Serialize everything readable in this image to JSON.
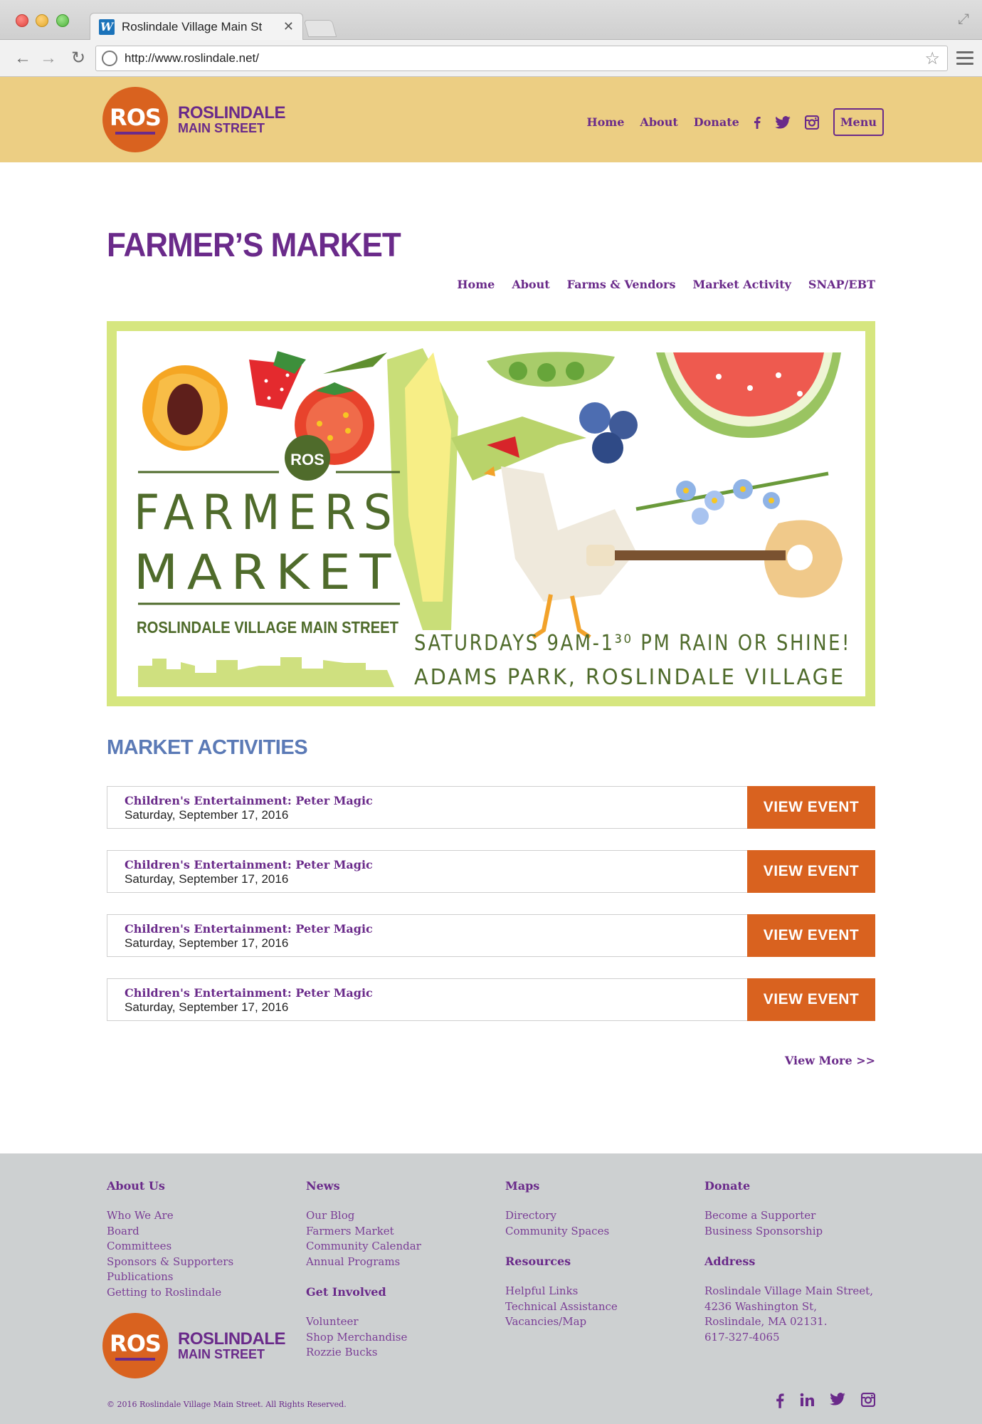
{
  "browser": {
    "tab_title": "Roslindale Village Main St",
    "favicon_letter": "W",
    "url": "http://www.roslindale.net/"
  },
  "header": {
    "logo_mark": "ROS",
    "logo_line1": "ROSLINDALE",
    "logo_line2": "MAIN STREET",
    "nav": [
      "Home",
      "About",
      "Donate"
    ],
    "menu_label": "Menu",
    "social_icons": [
      "facebook-icon",
      "twitter-icon",
      "instagram-icon"
    ]
  },
  "page": {
    "title": "FARMER’S MARKET",
    "sub_nav": [
      "Home",
      "About",
      "Farms & Vendors",
      "Market Activity",
      "SNAP/EBT"
    ]
  },
  "banner": {
    "badge": "ROS",
    "line1": "FARMERS",
    "line2": "MARKET",
    "org": "ROSLINDALE VILLAGE MAIN STREET",
    "schedule": "SATURDAYS 9AM-1³⁰ PM RAIN OR SHINE!",
    "location": "ADAMS PARK, ROSLINDALE VILLAGE"
  },
  "activities": {
    "title": "MARKET ACTIVITIES",
    "button_label": "VIEW EVENT",
    "events": [
      {
        "title": "Children's Entertainment: Peter Magic",
        "date": "Saturday, September 17, 2016"
      },
      {
        "title": "Children's Entertainment: Peter Magic",
        "date": "Saturday, September 17, 2016"
      },
      {
        "title": "Children's Entertainment: Peter Magic",
        "date": "Saturday, September 17, 2016"
      },
      {
        "title": "Children's Entertainment: Peter Magic",
        "date": "Saturday, September 17, 2016"
      }
    ],
    "view_more": "View More >>"
  },
  "footer": {
    "about": {
      "heading": "About Us",
      "links": [
        "Who We Are",
        "Board",
        "Committees",
        "Sponsors & Supporters",
        "Publications",
        "Getting to Roslindale"
      ]
    },
    "news": {
      "heading": "News",
      "links": [
        "Our Blog",
        "Farmers Market",
        "Community Calendar",
        "Annual Programs"
      ]
    },
    "get_involved": {
      "heading": "Get Involved",
      "links": [
        "Volunteer",
        "Shop Merchandise",
        "Rozzie Bucks"
      ]
    },
    "maps": {
      "heading": "Maps",
      "links": [
        "Directory",
        "Community Spaces"
      ]
    },
    "resources": {
      "heading": "Resources",
      "links": [
        "Helpful Links",
        "Technical Assistance",
        "Vacancies/Map"
      ]
    },
    "donate": {
      "heading": "Donate",
      "links": [
        "Become a Supporter",
        "Business Sponsorship"
      ]
    },
    "address": {
      "heading": "Address",
      "lines": [
        "Roslindale Village Main Street,",
        "4236 Washington St,",
        "Roslindale, MA 02131.",
        "617-327-4065"
      ]
    },
    "copyright": "© 2016 Roslindale Village Main Street. All Rights Reserved.",
    "social_icons": [
      "facebook-icon",
      "linkedin-icon",
      "twitter-icon",
      "instagram-icon"
    ]
  },
  "colors": {
    "purple": "#6a2a8a",
    "orange": "#d9621f",
    "header_bg": "#ecce83",
    "footer_bg": "#cdd0d1",
    "section_blue": "#5b7ab6",
    "banner_green": "#4f6b2b",
    "banner_border": "#d6e67f"
  }
}
